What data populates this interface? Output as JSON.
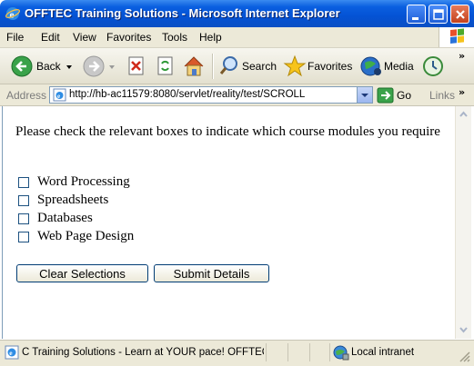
{
  "window": {
    "title": "OFFTEC Training Solutions - Microsoft Internet Explorer"
  },
  "menu": {
    "file": "File",
    "edit": "Edit",
    "view": "View",
    "favorites": "Favorites",
    "tools": "Tools",
    "help": "Help"
  },
  "toolbar": {
    "back": "Back",
    "search": "Search",
    "favorites": "Favorites",
    "media": "Media"
  },
  "address": {
    "label": "Address",
    "url": "http://hb-ac11579:8080/servlet/reality/test/SCROLL",
    "go": "Go",
    "links": "Links"
  },
  "page": {
    "instruction": "Please check the relevant boxes to indicate which course modules you require",
    "modules": [
      {
        "label": "Word Processing",
        "checked": false
      },
      {
        "label": "Spreadsheets",
        "checked": false
      },
      {
        "label": "Databases",
        "checked": false
      },
      {
        "label": "Web Page Design",
        "checked": false
      }
    ],
    "clear_button": "Clear Selections",
    "submit_button": "Submit Details"
  },
  "status": {
    "text": "C Training Solutions - Learn at YOUR pace!  OFFTEC Training",
    "zone": "Local intranet"
  },
  "colors": {
    "titlebar": "#0452d4",
    "chrome": "#ece9d8",
    "button_border": "#003c74"
  }
}
